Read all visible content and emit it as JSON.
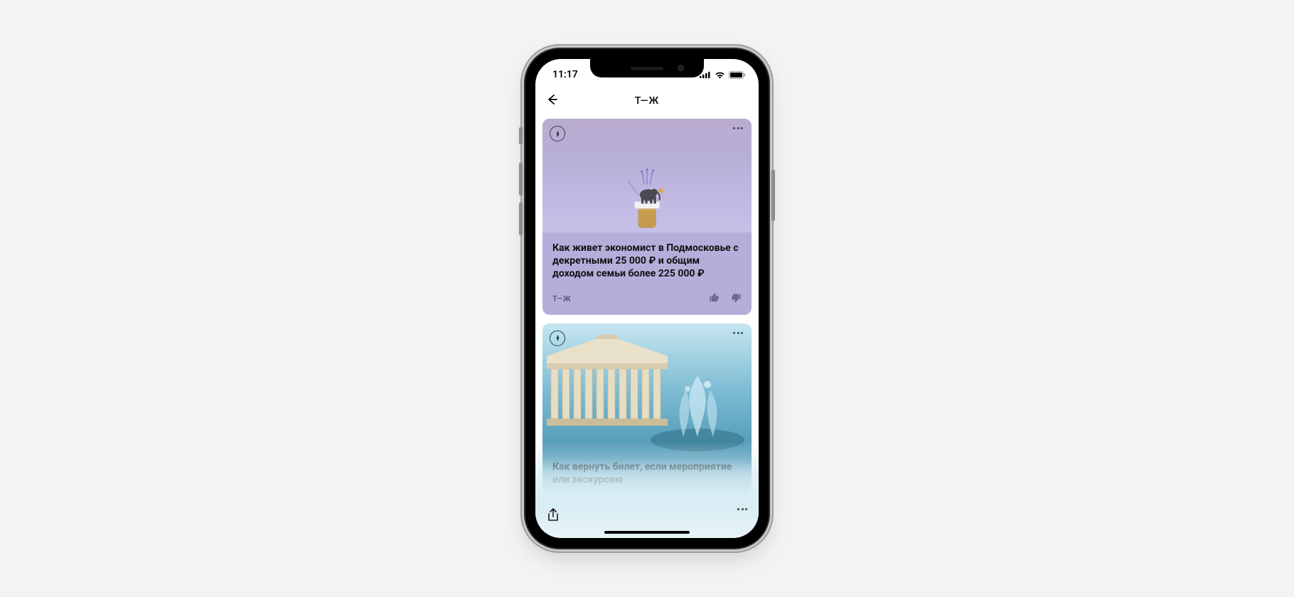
{
  "status": {
    "time": "11:17"
  },
  "header": {
    "title": "Т—Ж"
  },
  "feed": {
    "cards": [
      {
        "title": "Как живет экономист в Подмосковье с декретными 25 000 ₽ и общим доходом семьи более 225 000 ₽",
        "source": "Т—Ж"
      },
      {
        "title": "Как вернуть билет, если мероприятие или экскурсию"
      }
    ]
  }
}
